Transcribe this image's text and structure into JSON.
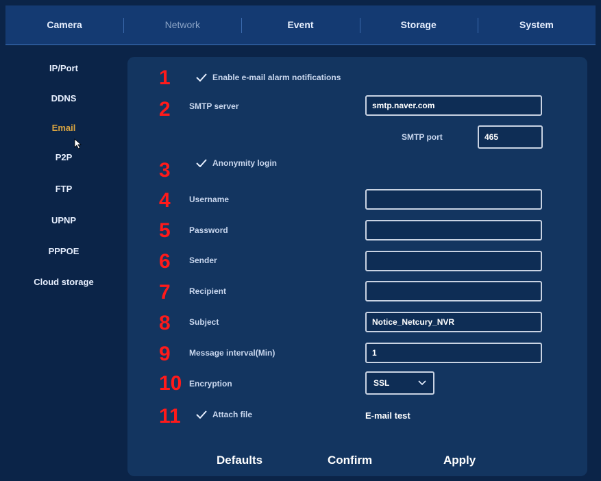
{
  "tabs": [
    {
      "label": "Camera"
    },
    {
      "label": "Network"
    },
    {
      "label": "Event"
    },
    {
      "label": "Storage"
    },
    {
      "label": "System"
    }
  ],
  "sidebar": {
    "items": [
      {
        "label": "IP/Port"
      },
      {
        "label": "DDNS"
      },
      {
        "label": "Email"
      },
      {
        "label": "P2P"
      },
      {
        "label": "FTP"
      },
      {
        "label": "UPNP"
      },
      {
        "label": "PPPOE"
      },
      {
        "label": "Cloud storage"
      }
    ]
  },
  "markers": [
    "1",
    "2",
    "3",
    "4",
    "5",
    "6",
    "7",
    "8",
    "9",
    "10",
    "11"
  ],
  "form": {
    "enable_label": "Enable e-mail alarm notifications",
    "smtp_server_label": "SMTP server",
    "smtp_server_value": "smtp.naver.com",
    "smtp_port_label": "SMTP port",
    "smtp_port_value": "465",
    "anonymity_label": "Anonymity login",
    "username_label": "Username",
    "username_value": "",
    "password_label": "Password",
    "password_value": "",
    "sender_label": "Sender",
    "sender_value": "",
    "recipient_label": "Recipient",
    "recipient_value": "",
    "subject_label": "Subject",
    "subject_value": "Notice_Netcury_NVR",
    "interval_label": "Message interval(Min)",
    "interval_value": "1",
    "encryption_label": "Encryption",
    "encryption_value": "SSL",
    "attach_label": "Attach file",
    "email_test_label": "E-mail test"
  },
  "buttons": {
    "defaults": "Defaults",
    "confirm": "Confirm",
    "apply": "Apply"
  },
  "colors": {
    "background": "#0b2448",
    "panel": "#133560",
    "marker": "#ff1a1a",
    "active_sidebar": "#d9a441"
  }
}
